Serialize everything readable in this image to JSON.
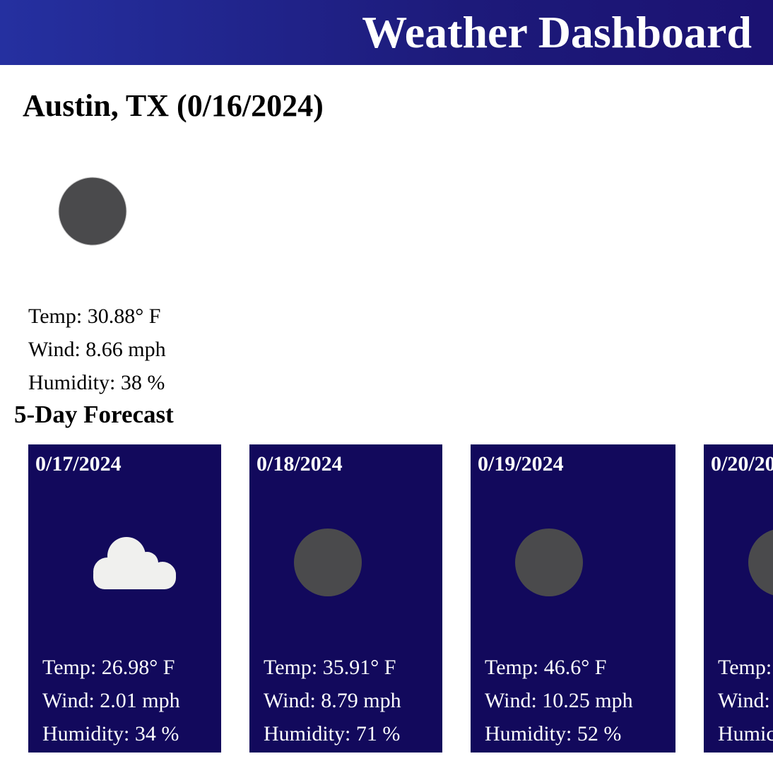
{
  "header": {
    "title": "Weather Dashboard"
  },
  "current": {
    "title": "Austin, TX (0/16/2024)",
    "icon": "moon-icon",
    "temp": "Temp: 30.88° F",
    "wind": "Wind: 8.66 mph",
    "humidity": "Humidity: 38 %"
  },
  "forecast": {
    "title": "5-Day Forecast",
    "days": [
      {
        "date": "0/17/2024",
        "icon": "cloud-icon",
        "temp": "Temp: 26.98° F",
        "wind": "Wind: 2.01 mph",
        "humidity": "Humidity: 34 %"
      },
      {
        "date": "0/18/2024",
        "icon": "moon-icon",
        "temp": "Temp: 35.91° F",
        "wind": "Wind: 8.79 mph",
        "humidity": "Humidity: 71 %"
      },
      {
        "date": "0/19/2024",
        "icon": "moon-icon",
        "temp": "Temp: 46.6° F",
        "wind": "Wind: 10.25 mph",
        "humidity": "Humidity: 52 %"
      },
      {
        "date": "0/20/20",
        "icon": "moon-icon",
        "temp": "Temp:",
        "wind": "Wind:",
        "humidity": "Humic"
      }
    ]
  },
  "colors": {
    "header_start": "#2530a0",
    "header_end": "#1b1272",
    "card_bg": "#12095c",
    "icon_dark": "#4a4a4c",
    "cloud": "#f0f0ee"
  }
}
